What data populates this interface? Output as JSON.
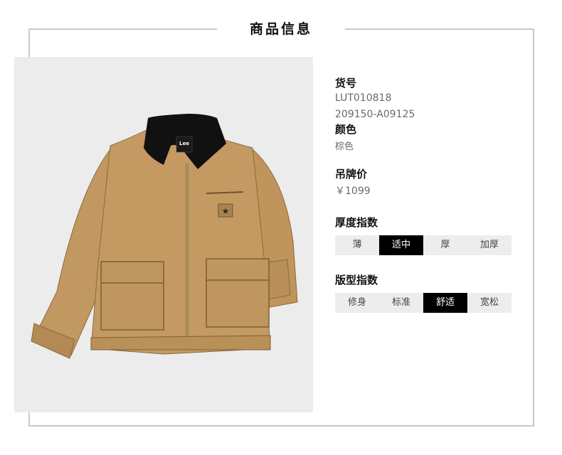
{
  "header": {
    "title": "商品信息"
  },
  "product": {
    "sku": {
      "label": "货号",
      "values": [
        "LUT010818",
        "209150-A09125"
      ]
    },
    "color": {
      "label": "颜色",
      "value": "棕色"
    },
    "price": {
      "label": "吊牌价",
      "value": "￥1099"
    },
    "thickness": {
      "label": "厚度指数",
      "options": [
        "薄",
        "适中",
        "厚",
        "加厚"
      ],
      "selected": "适中"
    },
    "fit": {
      "label": "版型指数",
      "options": [
        "修身",
        "标准",
        "舒适",
        "宽松"
      ],
      "selected": "舒适"
    },
    "image": {
      "alt": "",
      "badge_text": "Lee"
    }
  },
  "colors": {
    "jacket": "#c49a62",
    "collar": "#111111",
    "selected_bg": "#000000",
    "scale_bg": "#ededed"
  }
}
